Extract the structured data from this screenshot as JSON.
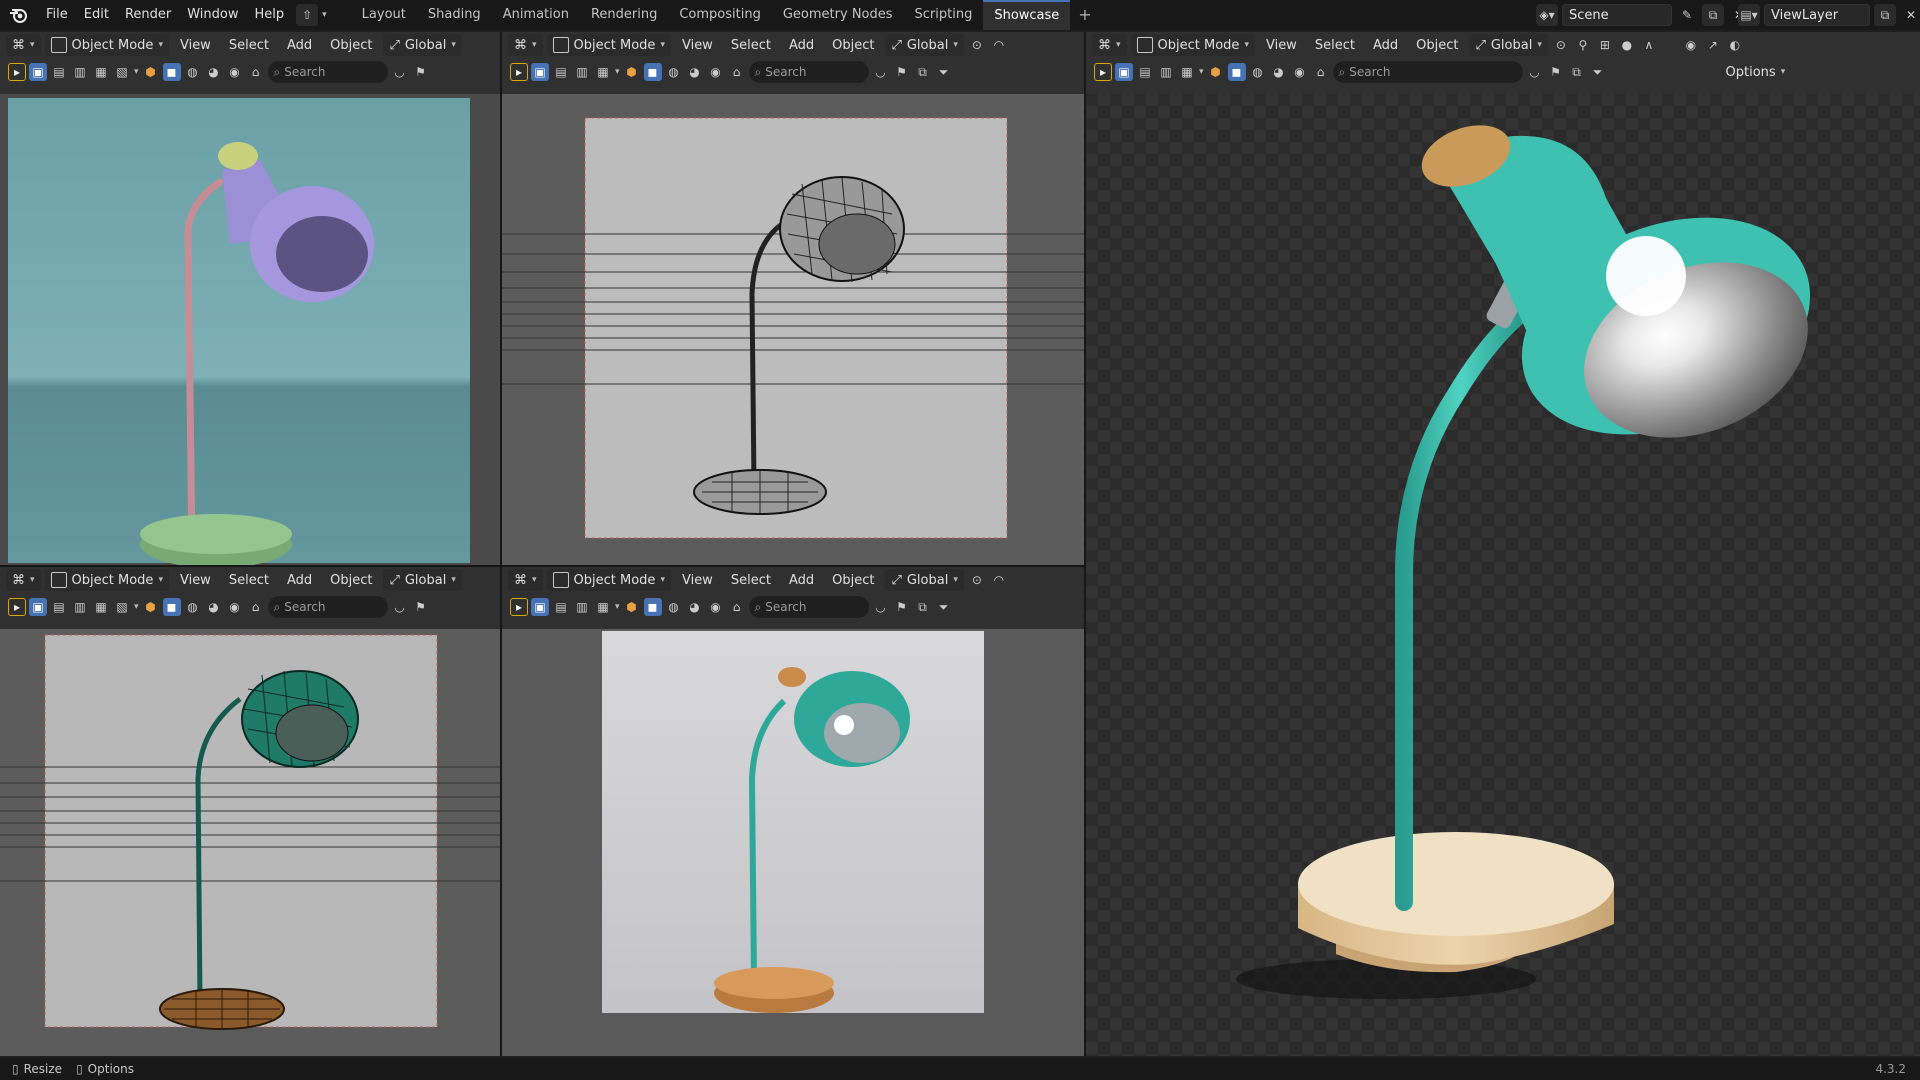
{
  "topbar": {
    "menus": [
      "File",
      "Edit",
      "Render",
      "Window",
      "Help"
    ],
    "tabs": [
      "Layout",
      "Shading",
      "Animation",
      "Rendering",
      "Compositing",
      "Geometry Nodes",
      "Scripting",
      "Showcase"
    ],
    "active_tab": "Showcase",
    "scene_label": "Scene",
    "viewlayer_label": "ViewLayer"
  },
  "viewport_header": {
    "mode": "Object Mode",
    "menus": [
      "View",
      "Select",
      "Add",
      "Object"
    ],
    "transform": "Global",
    "search_placeholder": "Search",
    "options_label": "Options"
  },
  "viewports": [
    {
      "id": "top-left",
      "shading": "solid",
      "lamp_colors": {
        "shade": "#9b8fd6",
        "arm": "#c88a92",
        "base": "#8dbf88"
      }
    },
    {
      "id": "top-middle",
      "shading": "wireframe"
    },
    {
      "id": "bottom-left",
      "shading": "wireframe-textured",
      "lamp_colors": {
        "shade": "#1f7a68",
        "base": "#8a5a2b"
      }
    },
    {
      "id": "bottom-middle",
      "shading": "material-preview",
      "lamp_colors": {
        "shade": "#2ea898",
        "base": "#c98a4a"
      }
    },
    {
      "id": "right",
      "shading": "rendered",
      "lamp_colors": {
        "shade": "#3fc1b1",
        "base": "#e4c89a"
      }
    }
  ],
  "statusbar": {
    "resize_label": "Resize",
    "options_label": "Options",
    "version": "4.3.2"
  },
  "colors": {
    "accent": "#4772b3",
    "active_tab": "#303030"
  }
}
